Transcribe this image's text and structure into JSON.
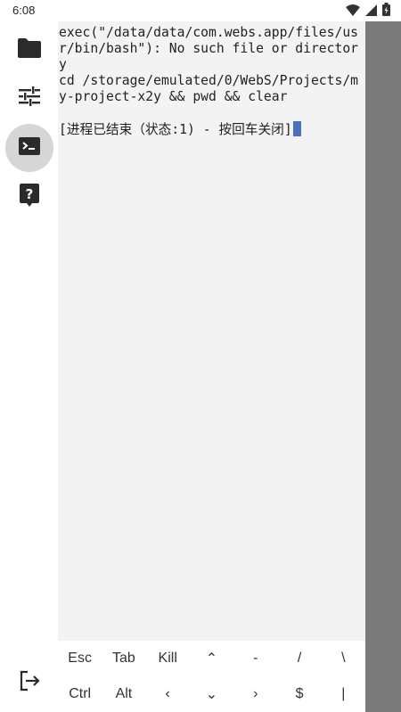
{
  "status_bar": {
    "time": "6:08",
    "icons": [
      "wifi-icon",
      "signal-icon",
      "battery-icon"
    ]
  },
  "sidebar": {
    "items": [
      {
        "name": "files",
        "icon": "folder-icon"
      },
      {
        "name": "settings",
        "icon": "tune-icon"
      },
      {
        "name": "terminal",
        "icon": "terminal-icon",
        "active": true
      },
      {
        "name": "help",
        "icon": "help-icon"
      }
    ],
    "bottom_icon": "logout-icon"
  },
  "terminal": {
    "lines": [
      "exec(\"/data/data/com.webs.app/files/usr/bin/bash\"): No such file or directory",
      "cd /storage/emulated/0/WebS/Projects/my-project-x2y && pwd && clear",
      "",
      "[进程已结束（状态:1) - 按回车关闭]"
    ]
  },
  "extra_keys": {
    "row1": [
      "Esc",
      "Tab",
      "Kill",
      "⌃",
      "-",
      "/",
      "\\"
    ],
    "row2": [
      "Ctrl",
      "Alt",
      "‹",
      "⌄",
      "›",
      "$",
      "|"
    ]
  },
  "colors": {
    "accent_cursor": "#4a70c0",
    "terminal_bg": "#f3f3f3",
    "side_panel": "#7a7a7a",
    "active_nav_bg": "#d6d6d6"
  }
}
